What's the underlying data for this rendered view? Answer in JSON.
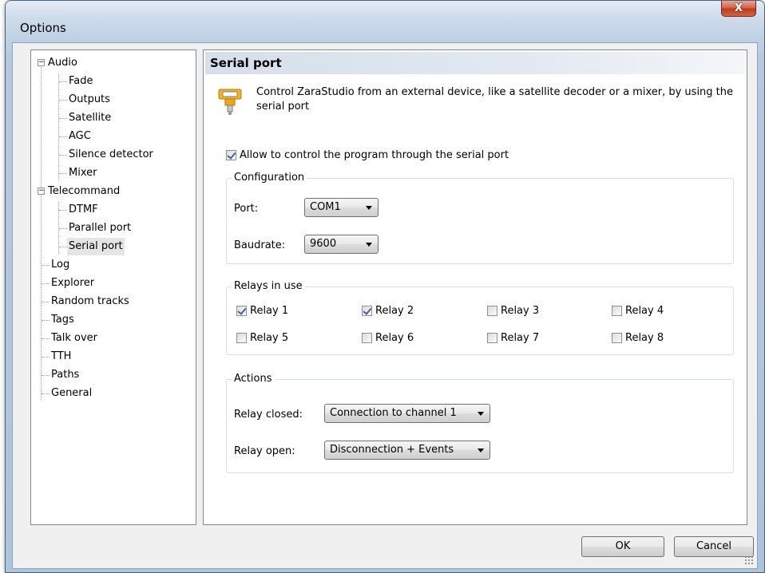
{
  "window": {
    "title": "Options",
    "close_glyph": "X"
  },
  "tree": {
    "groups": [
      {
        "label": "Audio",
        "expander": "−",
        "children": [
          "Fade",
          "Outputs",
          "Satellite",
          "AGC",
          "Silence detector",
          "Mixer"
        ]
      },
      {
        "label": "Telecommand",
        "expander": "−",
        "children": [
          "DTMF",
          "Parallel port",
          "Serial port"
        ]
      }
    ],
    "items": [
      "Log",
      "Explorer",
      "Random tracks",
      "Tags",
      "Talk over",
      "TTH",
      "Paths",
      "General"
    ],
    "selected": "Serial port"
  },
  "panel": {
    "title": "Serial port",
    "icon": "serial-port-icon",
    "description": "Control ZaraStudio from an external device, like a satellite decoder or a mixer, by using the serial port",
    "allow_control": {
      "label": "Allow to control the program through the serial port",
      "checked": true
    },
    "configuration": {
      "legend": "Configuration",
      "port_label": "Port:",
      "port_value": "COM1",
      "baudrate_label": "Baudrate:",
      "baudrate_value": "9600"
    },
    "relays": {
      "legend": "Relays in use",
      "items": [
        {
          "label": "Relay 1",
          "checked": true
        },
        {
          "label": "Relay 2",
          "checked": true
        },
        {
          "label": "Relay 3",
          "checked": false
        },
        {
          "label": "Relay 4",
          "checked": false
        },
        {
          "label": "Relay 5",
          "checked": false
        },
        {
          "label": "Relay 6",
          "checked": false
        },
        {
          "label": "Relay 7",
          "checked": false
        },
        {
          "label": "Relay 8",
          "checked": false
        }
      ]
    },
    "actions": {
      "legend": "Actions",
      "closed_label": "Relay closed:",
      "closed_value": "Connection to channel 1",
      "open_label": "Relay open:",
      "open_value": "Disconnection + Events"
    }
  },
  "buttons": {
    "ok": "OK",
    "cancel": "Cancel"
  },
  "colors": {
    "header_gradient": "#d6dfea",
    "check_mark": "#4a5f97",
    "close_red": "#c0391b"
  }
}
